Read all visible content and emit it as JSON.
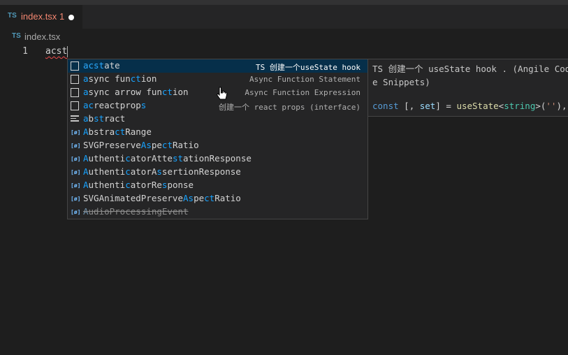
{
  "tab": {
    "icon": "TS",
    "name": "index.tsx",
    "problems": "1"
  },
  "breadcrumb": {
    "icon": "TS",
    "file": "index.tsx"
  },
  "editor": {
    "line_number": "1",
    "code": "acst"
  },
  "suggest": {
    "items": [
      {
        "icon": "snippet-icon",
        "pre": "",
        "match1": "acst",
        "mid": "ate",
        "match2": "",
        "rest": "",
        "detail": "TS 创建一个useState hook"
      },
      {
        "icon": "snippet-icon",
        "pre": "",
        "match1": "a",
        "mid": "sync fun",
        "match2": "ct",
        "rest": "ion",
        "detail": "Async Function Statement"
      },
      {
        "icon": "snippet-icon",
        "pre": "",
        "match1": "a",
        "mid": "sync arrow fun",
        "match2": "ct",
        "rest": "ion",
        "detail": "Async Function Expression"
      },
      {
        "icon": "snippet-icon",
        "pre": "",
        "match1": "ac",
        "mid": "reactprop",
        "match2": "s",
        "rest": "",
        "detail": "创建一个 react props (interface)"
      },
      {
        "icon": "keyword-icon",
        "pre": "",
        "match1": "a",
        "mid": "b",
        "match2": "st",
        "rest": "ract",
        "detail": ""
      },
      {
        "icon": "variable-icon",
        "pre": "",
        "match1": "A",
        "mid": "bstra",
        "match2": "ct",
        "rest": "Range",
        "detail": ""
      },
      {
        "icon": "variable-icon",
        "pre": "SVGPreserve",
        "match1": "As",
        "mid": "pe",
        "match2": "ct",
        "rest": "Ratio",
        "detail": ""
      },
      {
        "icon": "variable-icon",
        "pre": "",
        "match1": "A",
        "mid": "uthenti",
        "match2": "c",
        "rest": "atorAtte",
        "match3": "st",
        "rest2": "ationResponse",
        "detail": ""
      },
      {
        "icon": "variable-icon",
        "pre": "",
        "match1": "A",
        "mid": "uthenti",
        "match2": "c",
        "rest": "atorA",
        "match3": "s",
        "rest2": "sertionResponse",
        "detail": ""
      },
      {
        "icon": "variable-icon",
        "pre": "",
        "match1": "A",
        "mid": "uthenti",
        "match2": "c",
        "rest": "atorRe",
        "match3": "s",
        "rest2": "ponse",
        "detail": ""
      },
      {
        "icon": "variable-icon",
        "pre": "SVGAnimatedPreserve",
        "match1": "As",
        "mid": "pe",
        "match2": "ct",
        "rest": "Ratio",
        "detail": ""
      },
      {
        "icon": "variable-icon",
        "pre": "",
        "match1": "A",
        "mid": "udioProcessingEvent",
        "match2": "",
        "rest": "",
        "detail": "",
        "deprecated": true
      }
    ]
  },
  "details": {
    "description": "TS 创建一个 useState hook . (Angile Code\ne Snippets)",
    "code_kw": "const",
    "code_mid": " [, ",
    "code_set": "set",
    "code_close": "] = ",
    "code_fn": "useState",
    "code_lt": "<",
    "code_type": "string",
    "code_gt": ">(",
    "code_str": "''",
    "code_end": "),"
  }
}
